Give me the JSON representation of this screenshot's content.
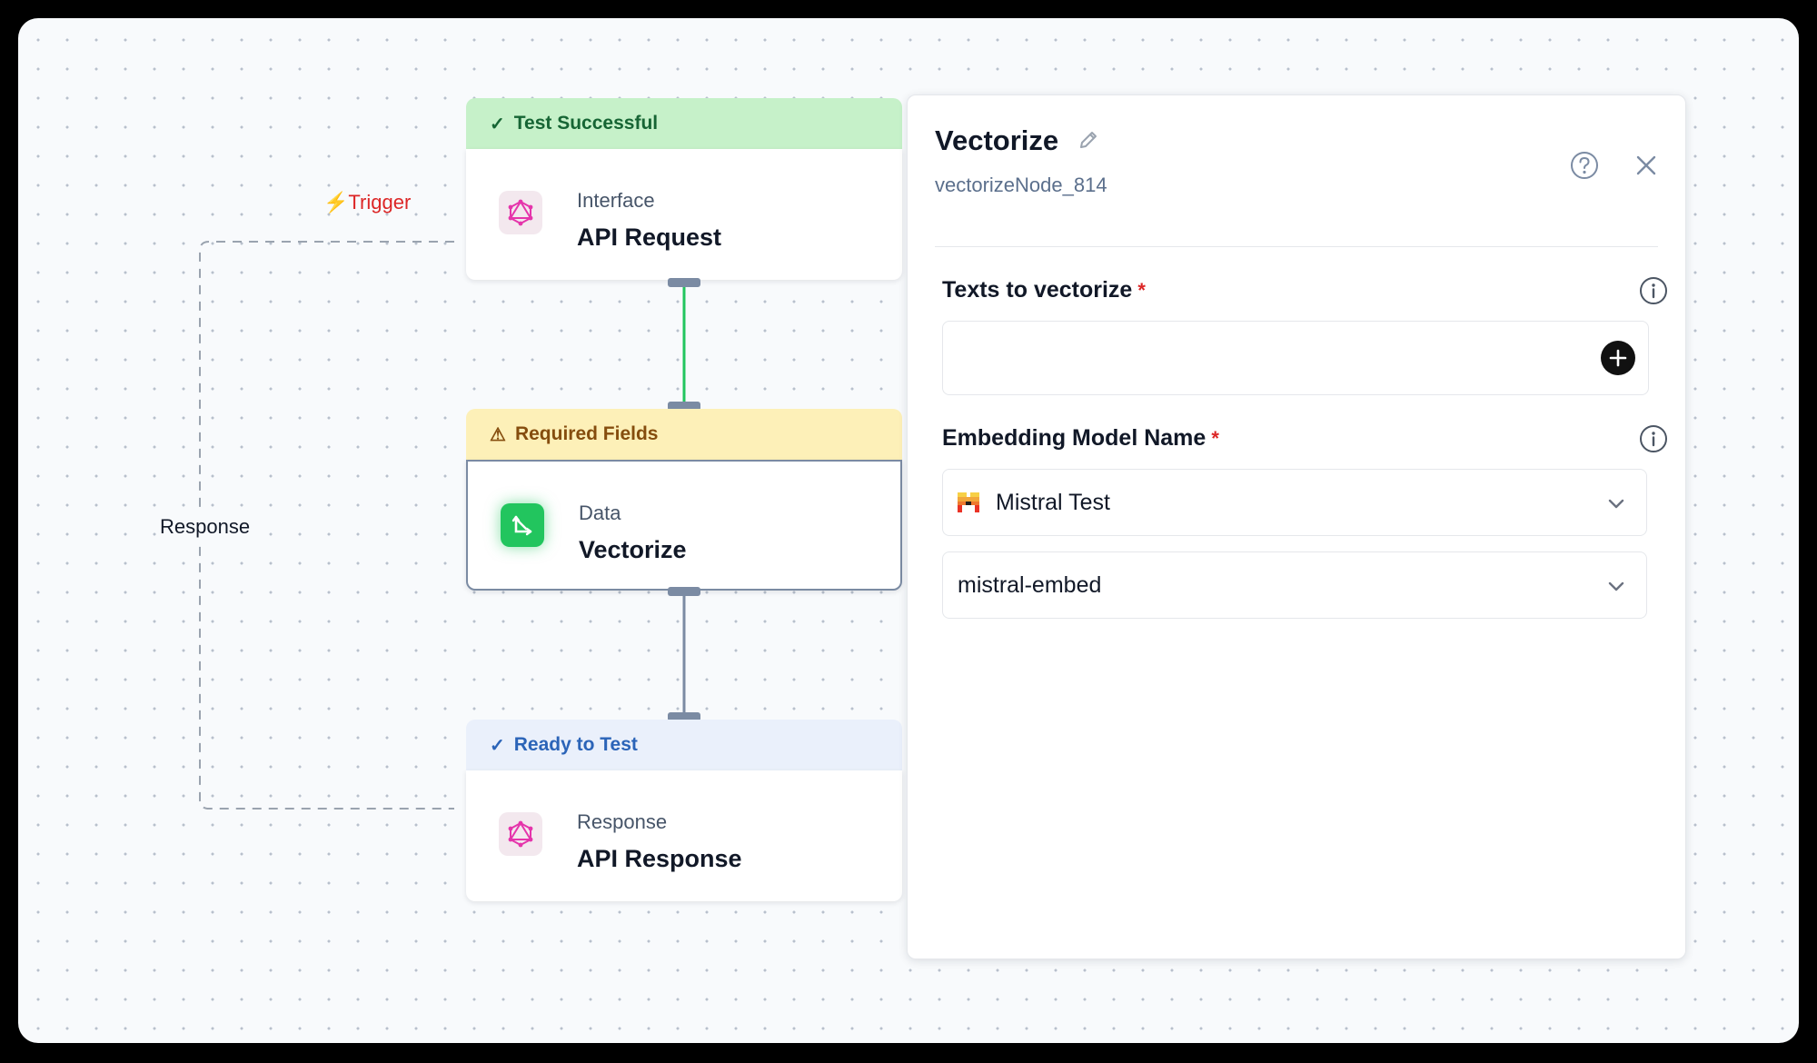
{
  "canvas": {
    "trigger_label": "Trigger",
    "response_label": "Response"
  },
  "nodes": [
    {
      "status": "Test Successful",
      "category": "Interface",
      "title": "API Request",
      "icon": "graphql-icon"
    },
    {
      "status": "Required Fields",
      "category": "Data",
      "title": "Vectorize",
      "icon": "vectorize-icon"
    },
    {
      "status": "Ready to Test",
      "category": "Response",
      "title": "API Response",
      "icon": "graphql-icon"
    }
  ],
  "panel": {
    "title": "Vectorize",
    "node_id": "vectorizeNode_814",
    "texts_label": "Texts to vectorize",
    "required_mark": "*",
    "embedding_label": "Embedding Model Name",
    "provider_value": "Mistral Test",
    "model_value": "mistral-embed"
  },
  "colors": {
    "success": "#c6f1c9",
    "warning": "#fdf0b8",
    "ready": "#eaf0fb",
    "trigger": "#dc2626",
    "edge_active": "#22c55e",
    "edge_idle": "#7b8ba3"
  }
}
